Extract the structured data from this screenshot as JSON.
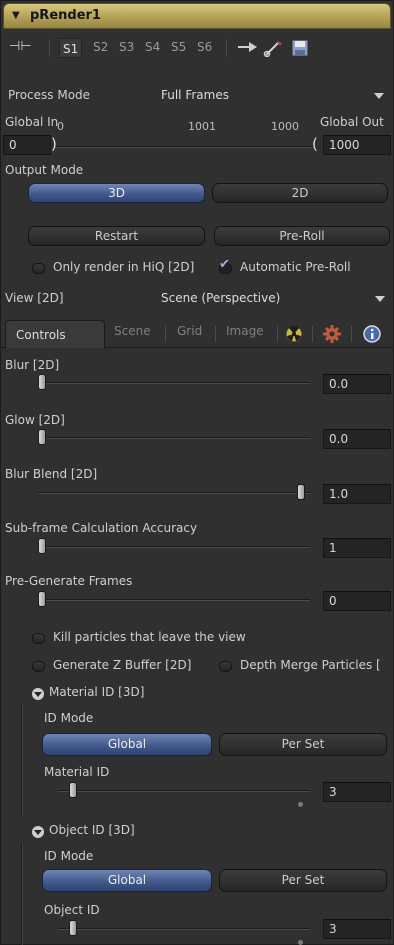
{
  "header": {
    "title": "pRender1"
  },
  "toolbar": {
    "slots": [
      "S1",
      "S2",
      "S3",
      "S4",
      "S5",
      "S6"
    ]
  },
  "process_mode": {
    "label": "Process Mode",
    "value": "Full Frames"
  },
  "global": {
    "in_label": "Global In",
    "in_value": "0",
    "out_label": "Global Out",
    "out_value": "1000",
    "ruler_left": "0",
    "ruler_mid": "1001",
    "ruler_right": "1000"
  },
  "output_mode": {
    "label": "Output Mode",
    "btn_3d": "3D",
    "btn_2d": "2D"
  },
  "buttons": {
    "restart": "Restart",
    "preroll": "Pre-Roll"
  },
  "checks": {
    "hiq": "Only render in HiQ [2D]",
    "auto_preroll": "Automatic Pre-Roll"
  },
  "view": {
    "label": "View [2D]",
    "value": "Scene (Perspective)"
  },
  "tabs": {
    "controls": "Controls",
    "scene": "Scene",
    "grid": "Grid",
    "image": "Image"
  },
  "sliders": {
    "blur": {
      "label": "Blur [2D]",
      "value": "0.0"
    },
    "glow": {
      "label": "Glow [2D]",
      "value": "0.0"
    },
    "blur_blend": {
      "label": "Blur Blend [2D]",
      "value": "1.0"
    },
    "subframe": {
      "label": "Sub-frame Calculation Accuracy",
      "value": "1"
    },
    "pregen": {
      "label": "Pre-Generate Frames",
      "value": "0"
    }
  },
  "options": {
    "kill": "Kill particles that leave the view",
    "zbuffer": "Generate Z Buffer [2D]",
    "depth_merge": "Depth Merge Particles ["
  },
  "material": {
    "section": "Material ID [3D]",
    "id_mode": "ID Mode",
    "global": "Global",
    "per_set": "Per Set",
    "id_label": "Material ID",
    "id_value": "3"
  },
  "object": {
    "section": "Object ID [3D]",
    "id_mode": "ID Mode",
    "global": "Global",
    "per_set": "Per Set",
    "id_label": "Object ID",
    "id_value": "3"
  },
  "colors": {
    "header": "#b3a156",
    "selected": "#435a8c",
    "panel": "#303030"
  }
}
